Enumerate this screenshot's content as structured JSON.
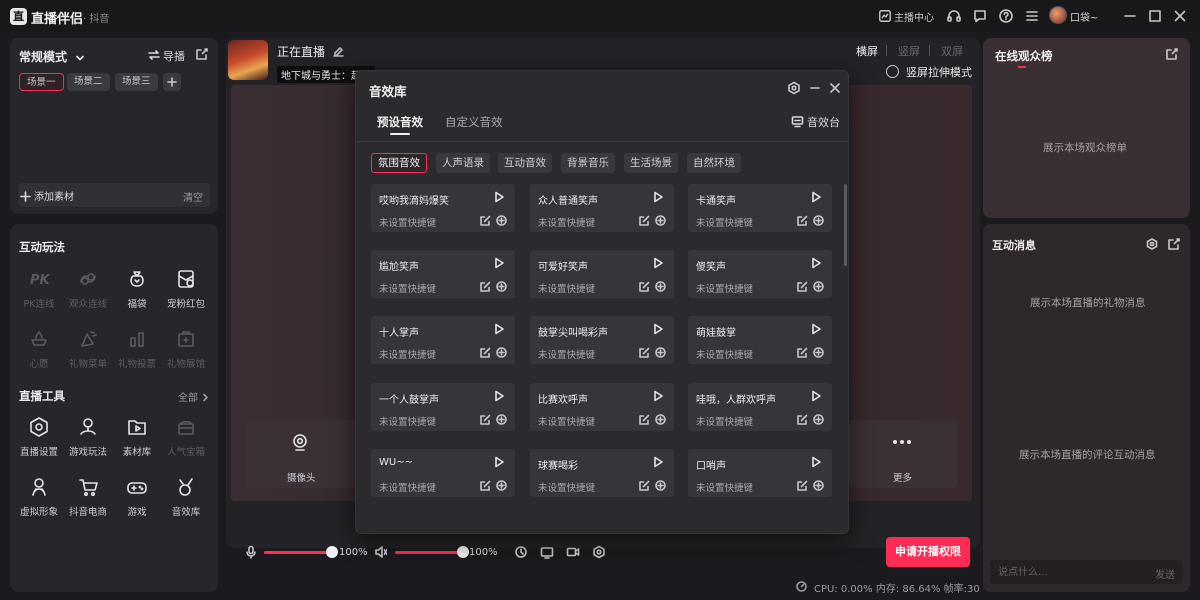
{
  "titlebar": {
    "logo_char": "直",
    "app_title": "直播伴侣",
    "app_sub": "· 抖音",
    "host_center": "主播中心",
    "user_name": "口袋~"
  },
  "scene_panel": {
    "mode_label": "常规模式",
    "import_label": "导播",
    "scenes": [
      "场景一",
      "场景二",
      "场景三"
    ],
    "add_material": "添加素材",
    "clear": "清空"
  },
  "interact": {
    "title": "互动玩法",
    "row1": [
      {
        "label": "PK连线",
        "icon": "pk-icon",
        "dim": true
      },
      {
        "label": "观众连线",
        "icon": "audience-link-icon",
        "dim": true
      },
      {
        "label": "福袋",
        "icon": "lucky-bag-icon",
        "dim": false
      },
      {
        "label": "宠粉红包",
        "icon": "red-packet-icon",
        "dim": false
      }
    ],
    "row2": [
      {
        "label": "心愿",
        "icon": "wish-icon",
        "dim": true
      },
      {
        "label": "礼物菜单",
        "icon": "gift-menu-icon",
        "dim": true
      },
      {
        "label": "礼物投票",
        "icon": "gift-vote-icon",
        "dim": true
      },
      {
        "label": "礼物展馆",
        "icon": "gift-gallery-icon",
        "dim": true
      }
    ]
  },
  "tools": {
    "title": "直播工具",
    "all_link": "全部",
    "row1": [
      {
        "label": "直播设置",
        "icon": "hexagon-settings-icon",
        "dim": false
      },
      {
        "label": "游戏玩法",
        "icon": "game-play-icon",
        "dim": false
      },
      {
        "label": "素材库",
        "icon": "material-library-icon",
        "dim": false
      },
      {
        "label": "人气宝箱",
        "icon": "treasure-box-icon",
        "dim": true
      }
    ],
    "row2": [
      {
        "label": "虚拟形象",
        "icon": "avatar-figure-icon",
        "dim": false
      },
      {
        "label": "抖音电商",
        "icon": "shopping-cart-icon",
        "dim": false
      },
      {
        "label": "游戏",
        "icon": "gamepad-icon",
        "dim": false
      },
      {
        "label": "音效库",
        "icon": "sound-effect-icon",
        "dim": false
      }
    ]
  },
  "stage": {
    "live_status": "正在直播",
    "game_tag": "地下城与勇士：起源",
    "orient": [
      "横屏",
      "竖屏",
      "双屏"
    ],
    "stretch_mode": "竖屏拉伸模式",
    "camera_label": "摄像头",
    "more_label": "更多"
  },
  "bottom": {
    "mic_volume": "100%",
    "speaker_volume": "100%",
    "mic_level": 1.0,
    "speaker_level": 1.0,
    "apply_btn": "申请开播权限",
    "status": "CPU: 0.00%   内存: 86.64%   帧率:30"
  },
  "right": {
    "rank_title": "在线观众榜",
    "rank_empty": "展示本场观众榜单",
    "msg_title": "互动消息",
    "gift_empty": "展示本场直播的礼物消息",
    "comment_empty": "展示本场直播的评论互动消息",
    "input_placeholder": "说点什么...",
    "send": "发送"
  },
  "modal": {
    "title": "音效库",
    "tabs": [
      "预设音效",
      "自定义音效"
    ],
    "sfx_board": "音效台",
    "categories": [
      "氛围音效",
      "人声语录",
      "互动音效",
      "背景音乐",
      "生活场景",
      "自然环境"
    ],
    "hotkey_text": "未设置快捷键",
    "sounds": [
      [
        "哎哟我滴妈爆笑",
        "众人普通笑声",
        "卡通笑声"
      ],
      [
        "尴尬笑声",
        "可爱好笑声",
        "傻笑声"
      ],
      [
        "十人掌声",
        "鼓掌尖叫喝彩声",
        "萌娃鼓掌"
      ],
      [
        "一个人鼓掌声",
        "比赛欢呼声",
        "哇哦，人群欢呼声"
      ],
      [
        "WU~~",
        "球赛喝彩",
        "口哨声"
      ]
    ]
  },
  "colors": {
    "accent": "#fe2c55",
    "panel": "#26262b",
    "modal": "#2a2a2f",
    "card": "#35353a"
  }
}
